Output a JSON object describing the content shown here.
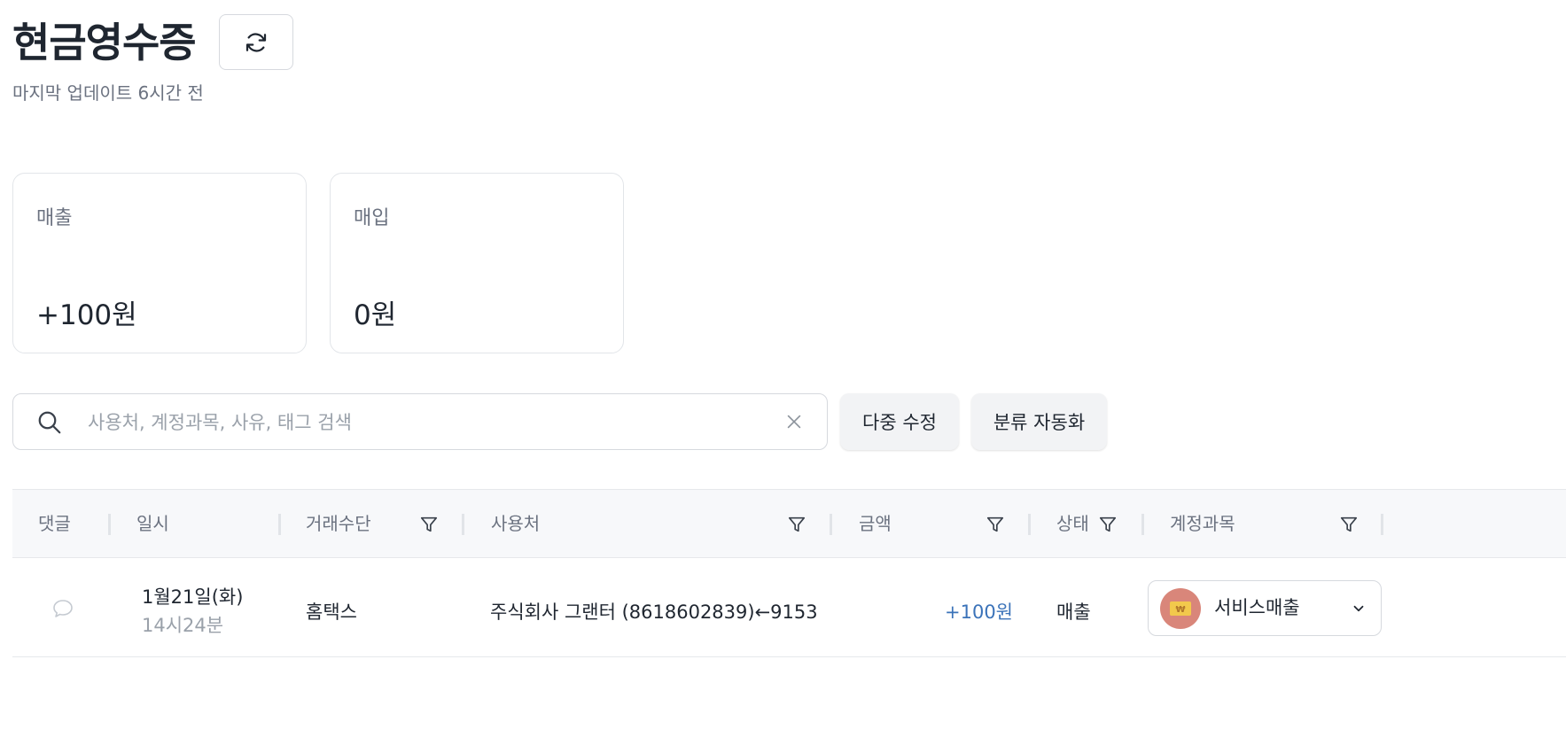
{
  "header": {
    "title": "현금영수증",
    "last_updated": "마지막 업데이트 6시간 전",
    "refresh_icon": "refresh-icon"
  },
  "summary": {
    "sales": {
      "label": "매출",
      "value": "+100원"
    },
    "purchases": {
      "label": "매입",
      "value": "0원"
    }
  },
  "search": {
    "placeholder": "사용처, 계정과목, 사유, 태그 검색",
    "value": ""
  },
  "actions": {
    "bulk_edit": "다중 수정",
    "auto_classify": "분류 자동화"
  },
  "table": {
    "columns": {
      "comment": "댓글",
      "date": "일시",
      "method": "거래수단",
      "merchant": "사용처",
      "amount": "금액",
      "status": "상태",
      "account": "계정과목"
    },
    "rows": [
      {
        "date": "1월21일(화)",
        "time": "14시24분",
        "method": "홈택스",
        "merchant": "주식회사 그랜터 (8618602839)←9153",
        "amount": "+100원",
        "status": "매출",
        "account": "서비스매출"
      }
    ]
  },
  "colors": {
    "amount_positive": "#3b73b9",
    "account_icon_bg": "#d9867a",
    "account_icon_fg": "#f2c94c"
  }
}
